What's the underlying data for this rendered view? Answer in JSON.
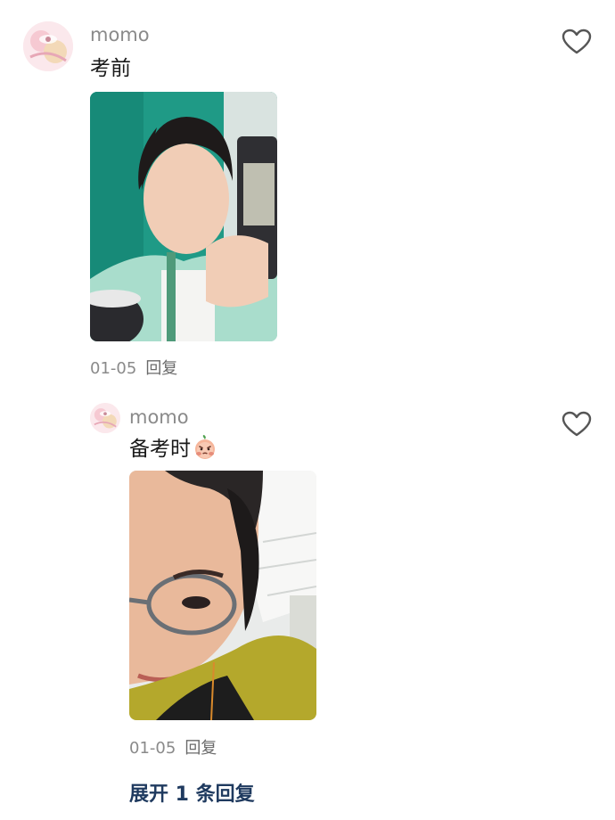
{
  "comment": {
    "username": "momo",
    "text": "考前",
    "date": "01-05",
    "reply_label": "回复",
    "photo_image": "selfie-with-phone-teal-wall"
  },
  "reply": {
    "username": "momo",
    "text": "备考时",
    "emoji": "angry-peach-emoji",
    "date": "01-05",
    "reply_label": "回复",
    "photo_image": "selfie-glasses-yellow-top"
  },
  "expand_label": "展开 1 条回复",
  "colors": {
    "username": "#8a8a8a",
    "expand_link": "#1f3a5f",
    "heart_outline": "#555555"
  }
}
